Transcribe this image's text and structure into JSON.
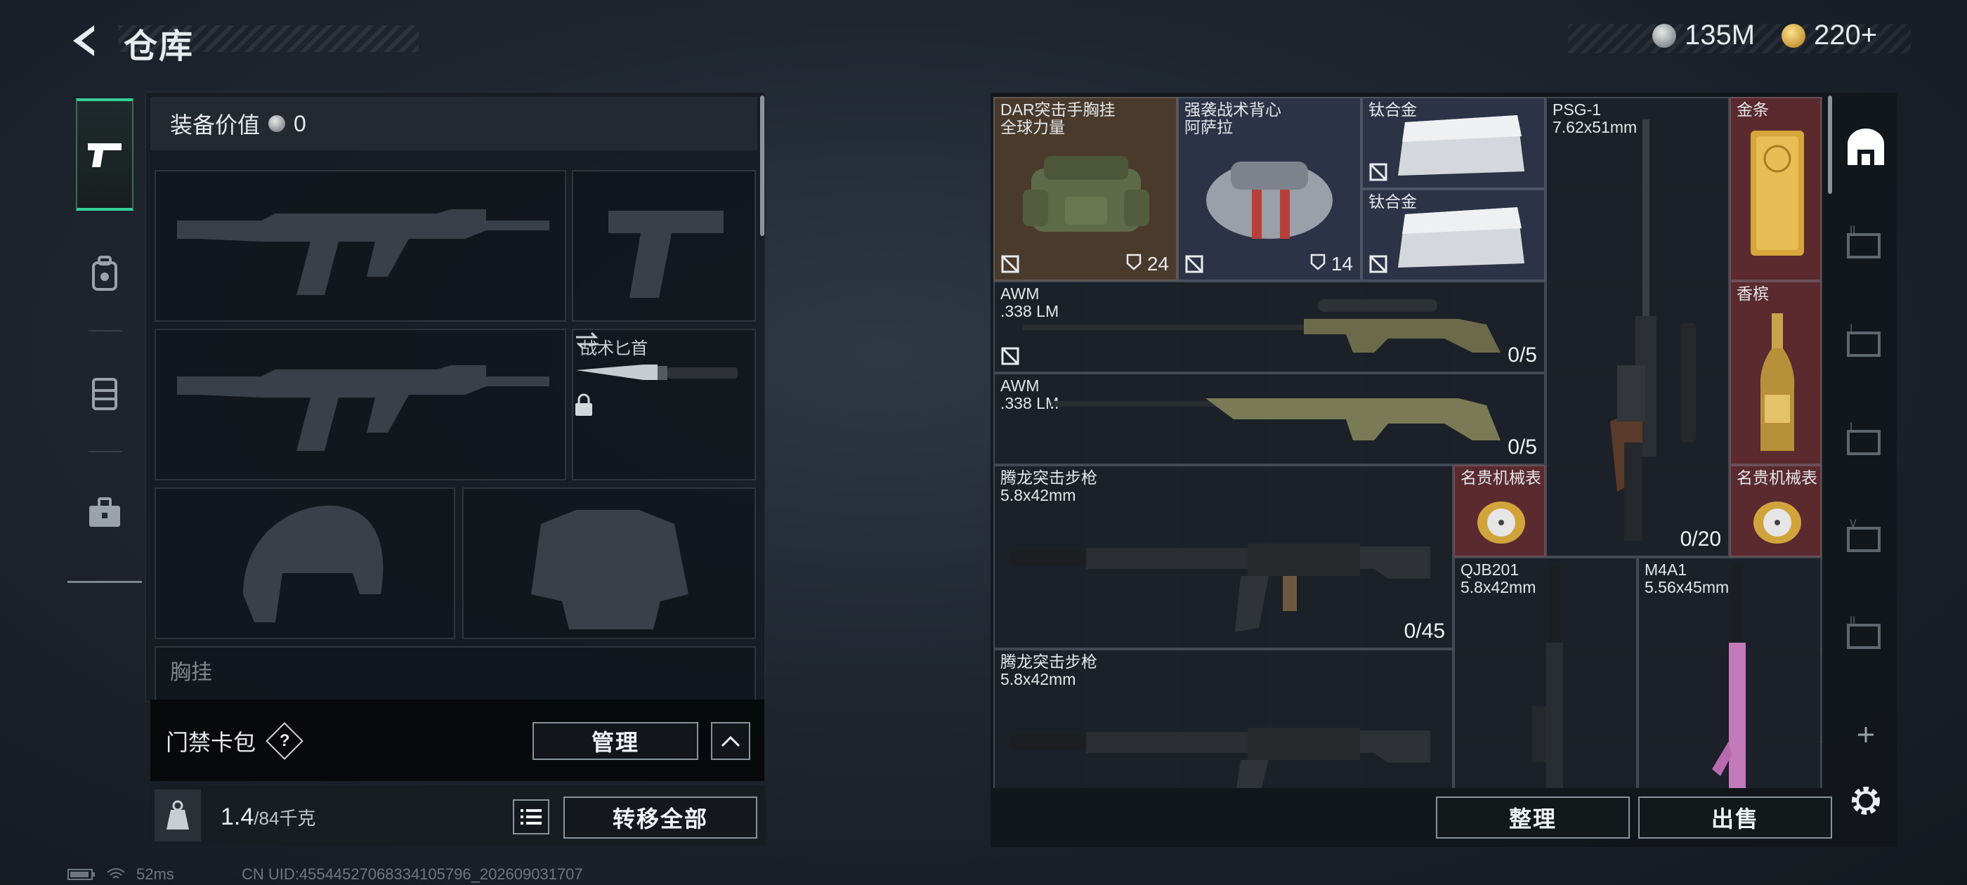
{
  "header": {
    "title": "仓库"
  },
  "currency": [
    {
      "icon": "silver-coin-icon",
      "value": "135M"
    },
    {
      "icon": "gold-coin-icon",
      "value": "220+"
    }
  ],
  "equipment": {
    "value_label": "装备价值",
    "value": "0",
    "slots": [
      {
        "label": ""
      },
      {
        "label": ""
      },
      {
        "label": ""
      },
      {
        "label": "战术匕首"
      },
      {
        "label": ""
      },
      {
        "label": ""
      },
      {
        "label": "胸挂"
      }
    ]
  },
  "keycard": {
    "label": "门禁卡包",
    "help": "?",
    "manage": "管理"
  },
  "weight": {
    "current": "1.4",
    "max": "/84千克",
    "transfer_all": "转移全部"
  },
  "status": {
    "ping": "52ms",
    "uid": "CN UID:45544527068334105796_202609031707"
  },
  "inventory": {
    "items": [
      {
        "name": "DAR突击手胸挂\n全球力量",
        "count": "24"
      },
      {
        "name": "强袭战术背心\n阿萨拉",
        "count": "14"
      },
      {
        "name": "钛合金"
      },
      {
        "name": "钛合金"
      },
      {
        "name": "PSG-1\n7.62x51mm",
        "ammo": "0/20"
      },
      {
        "name": "金条"
      },
      {
        "name": "香槟"
      },
      {
        "name": "AWM\n.338 LM",
        "ammo": "0/5"
      },
      {
        "name": "AWM\n.338 LM",
        "ammo": "0/5"
      },
      {
        "name": "腾龙突击步枪\n5.8x42mm",
        "ammo": "0/45"
      },
      {
        "name": "名贵机械表"
      },
      {
        "name": "名贵机械表"
      },
      {
        "name": "QJB201\n5.8x42mm"
      },
      {
        "name": "M4A1\n5.56x45mm"
      },
      {
        "name": "腾龙突击步枪\n5.8x42mm"
      }
    ],
    "sort_button": "整理",
    "sell_button": "出售"
  },
  "colors": {
    "accent_green": "#35d39a",
    "gold_bg": "#5a2a2f",
    "brown_bg": "#4a3a2c"
  }
}
